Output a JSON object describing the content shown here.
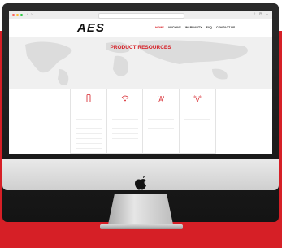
{
  "browser": {
    "url": ""
  },
  "site": {
    "logo": "AES",
    "menu": [
      {
        "label": "HOME",
        "active": true
      },
      {
        "label": "ARCHIVE",
        "active": false
      },
      {
        "label": "WARRANTY",
        "active": false
      },
      {
        "label": "FAQ",
        "active": false
      },
      {
        "label": "CONTACT US",
        "active": false
      }
    ],
    "hero_title": "PRODUCT RESOURCES",
    "hero_text": ""
  },
  "cards": [
    {
      "icon": "smartphone-icon",
      "title": "",
      "desc": "",
      "links": [
        "",
        "",
        "",
        "",
        "",
        "",
        "",
        ""
      ]
    },
    {
      "icon": "wifi-icon",
      "title": "",
      "desc": "",
      "links": [
        "",
        "",
        "",
        "",
        "",
        ""
      ]
    },
    {
      "icon": "radio-tower-icon",
      "title": "",
      "desc": "",
      "links": [
        "",
        "",
        "",
        ""
      ]
    },
    {
      "icon": "antenna-icon",
      "title": "",
      "desc": "",
      "links": [
        "",
        "",
        ""
      ]
    }
  ],
  "colors": {
    "accent": "#d61f26",
    "background": "#d61f26"
  }
}
